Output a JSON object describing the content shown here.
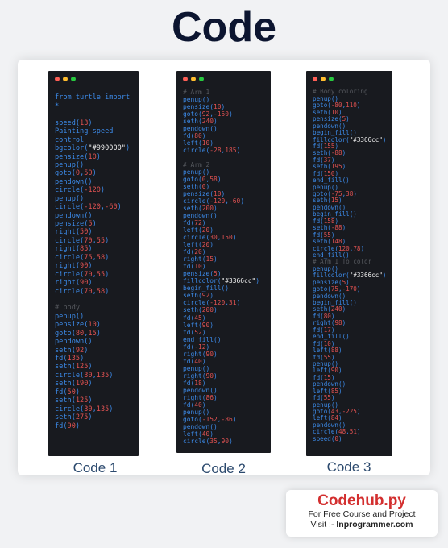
{
  "title": "Code",
  "windows": [
    {
      "caption": "Code 1",
      "lines": [
        "",
        "from turtle import",
        "*",
        "",
        "speed(13) #",
        "Painting speed",
        "control",
        "bgcolor(\"#990000\")",
        "pensize(10)",
        "penup()",
        "goto(0,50)",
        "pendown()",
        "circle(-120)",
        "penup()",
        "circle(-120,-60)",
        "pendown()",
        "pensize(5)",
        "right(50)",
        "circle(70,55)",
        "right(85)",
        "circle(75,58)",
        "right(90)",
        "circle(70,55)",
        "right(90)",
        "circle(70,58)",
        "",
        "# body",
        "penup()",
        "pensize(10)",
        "goto(80,15)",
        "pendown()",
        "seth(92)",
        "fd(135)",
        "seth(125)",
        "circle(30,135)",
        "seth(190)",
        "fd(50)",
        "seth(125)",
        "circle(30,135)",
        "seth(275)",
        "fd(90)"
      ]
    },
    {
      "caption": "Code 2",
      "lines": [
        "",
        "# Arm 1",
        "penup()",
        "pensize(10)",
        "goto(92,-150)",
        "seth(240)",
        "pendown()",
        "fd(80)",
        "left(10)",
        "circle(-28,185)",
        "",
        "# Arm 2",
        "penup()",
        "goto(0,58)",
        "seth(0)",
        "pensize(10)",
        "circle(-120,-60)",
        "seth(200)",
        "pendown()",
        "fd(72)",
        "left(20)",
        "circle(30,150)",
        "left(20)",
        "fd(20)",
        "right(15)",
        "fd(10)",
        "pensize(5)",
        "fillcolor(\"#3366cc\")",
        "begin_fill()",
        "seth(92)",
        "circle(-120,31)",
        "seth(200)",
        "fd(45)",
        "left(90)",
        "fd(52)",
        "end_fill()",
        "fd(-12)",
        "right(90)",
        "fd(40)",
        "penup()",
        "right(90)",
        "fd(18)",
        "pendown()",
        "right(86)",
        "fd(40)",
        "penup()",
        "goto(-152,-86)",
        "pendown()",
        "left(40)",
        "circle(35,90)"
      ]
    },
    {
      "caption": "Code 3",
      "lines": [
        "",
        "# Body coloring",
        "penup()",
        "goto(-80,110)",
        "seth(10)",
        "pensize(5)",
        "pendown()",
        "begin_fill()",
        "fillcolor(\"#3366cc\")",
        "fd(155)",
        "seth(-88)",
        "fd(37)",
        "seth(195)",
        "fd(150)",
        "end_fill()",
        "penup()",
        "goto(-75,38)",
        "seth(15)",
        "pendown()",
        "begin_fill()",
        "fd(158)",
        "seth(-88)",
        "fd(55)",
        "seth(148)",
        "circle(120,78)",
        "end_fill()",
        "# Arm 1 To color",
        "penup()",
        "fillcolor(\"#3366cc\")",
        "pensize(5)",
        "goto(75,-170)",
        "pendown()",
        "begin_fill()",
        "seth(240)",
        "fd(80)",
        "right(98)",
        "fd(17)",
        "end_fill()",
        "fd(10)",
        "left(88)",
        "fd(55)",
        "penup()",
        "left(90)",
        "fd(15)",
        "pendown()",
        "left(85)",
        "fd(55)",
        "penup()",
        "goto(43,-225)",
        "left(84)",
        "pendown()",
        "circle(48,51)",
        "speed(0)"
      ]
    }
  ],
  "brand": {
    "name": "Codehub.py",
    "tagline": "For Free Course and Project",
    "visit_prefix": "Visit :- ",
    "visit_site": "Inprogrammer.com"
  },
  "colors": {
    "title": "#0c1530",
    "code_bg": "#181a1f",
    "code_text": "#3c8ae8",
    "code_number": "#e05252",
    "code_comment": "#56595f",
    "brand_name": "#d32f2f"
  }
}
